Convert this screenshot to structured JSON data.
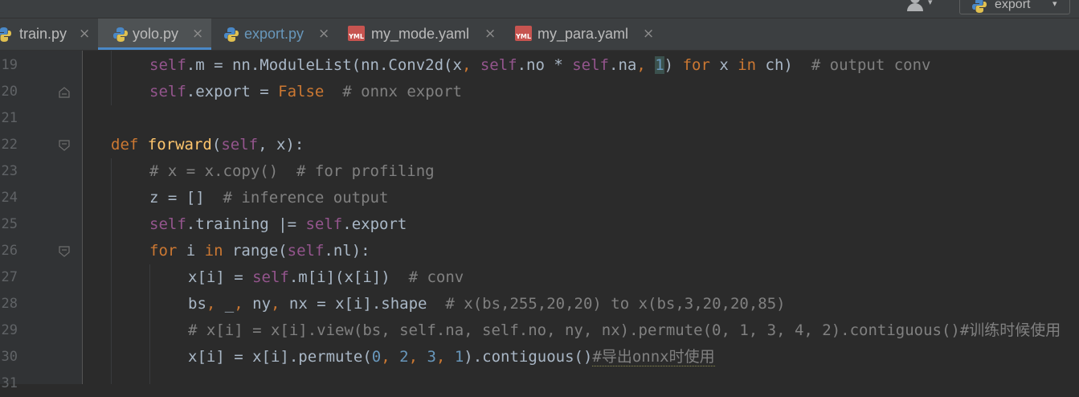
{
  "toolbar": {
    "run_config_label": "export",
    "user_icon": "user-icon",
    "dropdown_icon": "chevron-down-icon"
  },
  "tabs": [
    {
      "label": "train.py",
      "icon": "python-file-icon",
      "active": false
    },
    {
      "label": "yolo.py",
      "icon": "python-file-icon",
      "active": true
    },
    {
      "label": "export.py",
      "icon": "python-file-icon",
      "active": false,
      "modified": true
    },
    {
      "label": "my_mode.yaml",
      "icon": "yaml-file-icon",
      "active": false
    },
    {
      "label": "my_para.yaml",
      "icon": "yaml-file-icon",
      "active": false
    }
  ],
  "tab_close_glyph": "×",
  "yaml_icon_text": "YML",
  "colors": {
    "keyword": "#cc7832",
    "self": "#94558d",
    "number": "#6897bb",
    "comment": "#808080",
    "function": "#ffc66d",
    "text": "#a9b7c6",
    "background": "#2b2b2b",
    "active_tab_underline": "#4a88c7"
  },
  "editor": {
    "lines": [
      {
        "num": "19"
      },
      {
        "num": "20"
      },
      {
        "num": "21"
      },
      {
        "num": "22"
      },
      {
        "num": "23"
      },
      {
        "num": "24"
      },
      {
        "num": "25"
      },
      {
        "num": "26"
      },
      {
        "num": "27"
      },
      {
        "num": "28"
      },
      {
        "num": "29"
      },
      {
        "num": "30"
      },
      {
        "num": "31"
      }
    ],
    "tokens": {
      "l19": [
        "self",
        ".m = nn.ModuleList(nn.Conv2d(x",
        ", ",
        "self",
        ".no * ",
        "self",
        ".na",
        ", ",
        "1",
        ") ",
        "for",
        " x ",
        "in",
        " ch)  ",
        "# output conv"
      ],
      "l20": [
        "self",
        ".export = ",
        "False",
        "  ",
        "# onnx export"
      ],
      "l22": [
        "def",
        " ",
        "forward",
        "(",
        "self",
        ", x):"
      ],
      "l23": [
        "# x = x.copy()  # for profiling"
      ],
      "l24": [
        "z = []  ",
        "# inference output"
      ],
      "l25": [
        "self",
        ".training |= ",
        "self",
        ".export"
      ],
      "l26": [
        "for",
        " i ",
        "in",
        " range(",
        "self",
        ".nl):"
      ],
      "l27": [
        "x[i] = ",
        "self",
        ".m[i](x[i])  ",
        "# conv"
      ],
      "l28": [
        "bs",
        ", ",
        "_",
        ", ",
        "ny",
        ", ",
        "nx = x[i].shape  ",
        "# x(bs,255,20,20) to x(bs,3,20,20,85)"
      ],
      "l29": [
        "# x[i] = x[i].view(bs, self.na, self.no, ny, nx).permute(0, 1, 3, 4, 2).contiguous()#训练时候使用"
      ],
      "l30": [
        "x[i] = x[i].permute(",
        "0",
        ", ",
        "2",
        ", ",
        "3",
        ", ",
        "1",
        ").contiguous()",
        "#导出onnx时使用"
      ]
    }
  }
}
